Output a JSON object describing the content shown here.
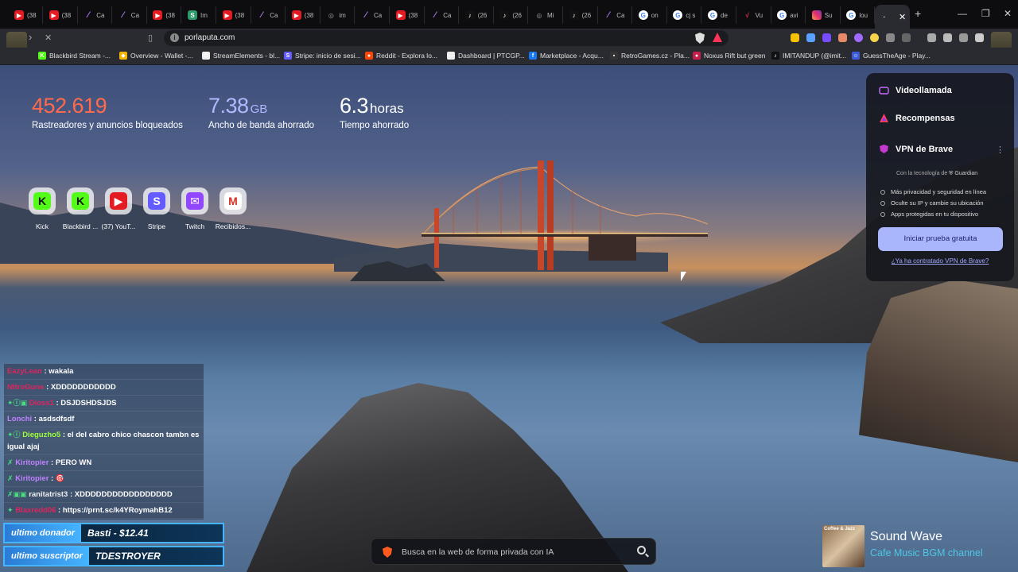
{
  "tabs": [
    {
      "icon": "youtube-icon",
      "label": "(38",
      "fav": "yt"
    },
    {
      "icon": "youtube-icon",
      "label": "(38",
      "fav": "yt"
    },
    {
      "icon": "capcut-icon",
      "label": "Ca",
      "fav": "cap"
    },
    {
      "icon": "capcut-icon",
      "label": "Ca",
      "fav": "cap"
    },
    {
      "icon": "youtube-icon",
      "label": "(38",
      "fav": "yt"
    },
    {
      "icon": "imt-icon",
      "label": "Im",
      "fav": "imt"
    },
    {
      "icon": "youtube-icon",
      "label": "(38",
      "fav": "yt"
    },
    {
      "icon": "capcut-icon",
      "label": "Ca",
      "fav": "cap"
    },
    {
      "icon": "youtube-icon",
      "label": "(38",
      "fav": "yt"
    },
    {
      "icon": "globe-icon",
      "label": "im",
      "fav": "mi"
    },
    {
      "icon": "capcut-icon",
      "label": "Ca",
      "fav": "cap"
    },
    {
      "icon": "youtube-icon",
      "label": "(38",
      "fav": "yt"
    },
    {
      "icon": "capcut-icon",
      "label": "Ca",
      "fav": "cap"
    },
    {
      "icon": "tiktok-icon",
      "label": "(26",
      "fav": "tt"
    },
    {
      "icon": "tiktok-icon",
      "label": "(26",
      "fav": "tt"
    },
    {
      "icon": "mi-icon",
      "label": "Mi",
      "fav": "mi"
    },
    {
      "icon": "tiktok-icon",
      "label": "(26",
      "fav": "tt"
    },
    {
      "icon": "capcut-icon",
      "label": "Ca",
      "fav": "cap"
    },
    {
      "icon": "google-icon",
      "label": "on",
      "fav": "ggl"
    },
    {
      "icon": "google-icon",
      "label": "cj s",
      "fav": "ggl"
    },
    {
      "icon": "google-icon",
      "label": "de",
      "fav": "ggl"
    },
    {
      "icon": "vu-icon",
      "label": "Vu",
      "fav": "vu"
    },
    {
      "icon": "google-icon",
      "label": "avi",
      "fav": "ggl"
    },
    {
      "icon": "instagram-icon",
      "label": "Su",
      "fav": "ig"
    },
    {
      "icon": "google-icon",
      "label": "lou",
      "fav": "ggl"
    }
  ],
  "omnibox": {
    "url": "porlaputa.com"
  },
  "bookmarks": [
    {
      "label": "Blackbird Stream -...",
      "color": "#53fc18",
      "glyph": "K"
    },
    {
      "label": "Overview - Wallet -...",
      "color": "#f5b400",
      "glyph": "◆"
    },
    {
      "label": "StreamElements - bl...",
      "color": "#eee",
      "glyph": "⚙"
    },
    {
      "label": "Stripe: inicio de sesi...",
      "color": "#635bff",
      "glyph": "S"
    },
    {
      "label": "Reddit - Explora lo...",
      "color": "#ff4500",
      "glyph": "●"
    },
    {
      "label": "Dashboard | PTCGP...",
      "color": "#eee",
      "glyph": "▭"
    },
    {
      "label": "Marketplace - Acqu...",
      "color": "#1877f2",
      "glyph": "f"
    },
    {
      "label": "RetroGames.cz - Pla...",
      "color": "#333",
      "glyph": "▪"
    },
    {
      "label": "Noxus Rift but green",
      "color": "#c81e4a",
      "glyph": "●"
    },
    {
      "label": "IMITANDUP (@imit...",
      "color": "#111",
      "glyph": "♪"
    },
    {
      "label": "GuessTheAge - Play...",
      "color": "#3b5bdb",
      "glyph": "☺"
    }
  ],
  "stats": {
    "trackers": {
      "value": "452.619",
      "label": "Rastreadores y anuncios bloqueados",
      "color": "#ff6a4d"
    },
    "bandwidth": {
      "value": "7.38",
      "unit": "GB",
      "label": "Ancho de banda ahorrado",
      "color": "#b0b8ff"
    },
    "time": {
      "value": "6.3",
      "unit": "horas",
      "label": "Tiempo ahorrado",
      "color": "#ffffff"
    }
  },
  "top_sites": [
    {
      "name": "Kick",
      "glyph": "K",
      "color": "#53fc18",
      "text": "#111"
    },
    {
      "name": "Blackbird ...",
      "glyph": "K",
      "color": "#53fc18",
      "text": "#111"
    },
    {
      "name": "(37) YouT...",
      "glyph": "▶",
      "color": "#e31c23",
      "text": "#fff"
    },
    {
      "name": "Stripe",
      "glyph": "S",
      "color": "#635bff",
      "text": "#fff"
    },
    {
      "name": "Twitch",
      "glyph": "✉",
      "color": "#9146ff",
      "text": "#fff"
    },
    {
      "name": "Recibidos...",
      "glyph": "M",
      "color": "#ffffff",
      "text": "#d93025"
    }
  ],
  "vpn_panel": {
    "videocall": "Videollamada",
    "rewards": "Recompensas",
    "vpn_title": "VPN de Brave",
    "powered_by": "Con la tecnología de",
    "guardian": "Guardian",
    "features": [
      "Más privacidad y seguridad en línea",
      "Oculte su IP y cambie su ubicación",
      "Apps protegidas en tu dispositivo"
    ],
    "cta": "Iniciar prueba gratuita",
    "link": "¿Ya ha contratado VPN de Brave?"
  },
  "chat": [
    {
      "user": "EazyLean",
      "color": "#e0245e",
      "text": "wakala",
      "badges": ""
    },
    {
      "user": "NitroGuns",
      "color": "#e0245e",
      "text": "XDDDDDDDDDDD",
      "badges": ""
    },
    {
      "user": "Dioss1",
      "color": "#e0245e",
      "text": "DSJDSHDSJDS",
      "badges": "✦ⓘ▣"
    },
    {
      "user": "Lonchi",
      "color": "#c081ff",
      "text": "asdsdfsdf",
      "badges": ""
    },
    {
      "user": "Dieguzho5",
      "color": "#9cff3c",
      "text": "el del cabro chico chascon tambn es igual ajaj",
      "badges": "✦ⓘ"
    },
    {
      "user": "Kiritopier",
      "color": "#c081ff",
      "text": "PERO WN",
      "badges": "✗"
    },
    {
      "user": "Kiritopier",
      "color": "#c081ff",
      "text": "🎯",
      "badges": "✗"
    },
    {
      "user": "ranitatrist3",
      "color": "#eee",
      "text": "XDDDDDDDDDDDDDDDDD",
      "badges": "✗▣▣"
    },
    {
      "user": "Blaxredd06",
      "color": "#e0245e",
      "text": "https://prnt.sc/k4YRoymahB12",
      "badges": "✦"
    }
  ],
  "overlays": {
    "donor_tag": "ultimo donador",
    "donor_value": "Basti - $12.41",
    "sub_tag": "ultimo suscriptor",
    "sub_value": "TDESTROYER"
  },
  "search": {
    "placeholder": "Busca en la web de forma privada con IA"
  },
  "music": {
    "cover_text": "Coffee & Jazz",
    "title": "Sound Wave",
    "subtitle": "Cafe Music BGM channel"
  }
}
